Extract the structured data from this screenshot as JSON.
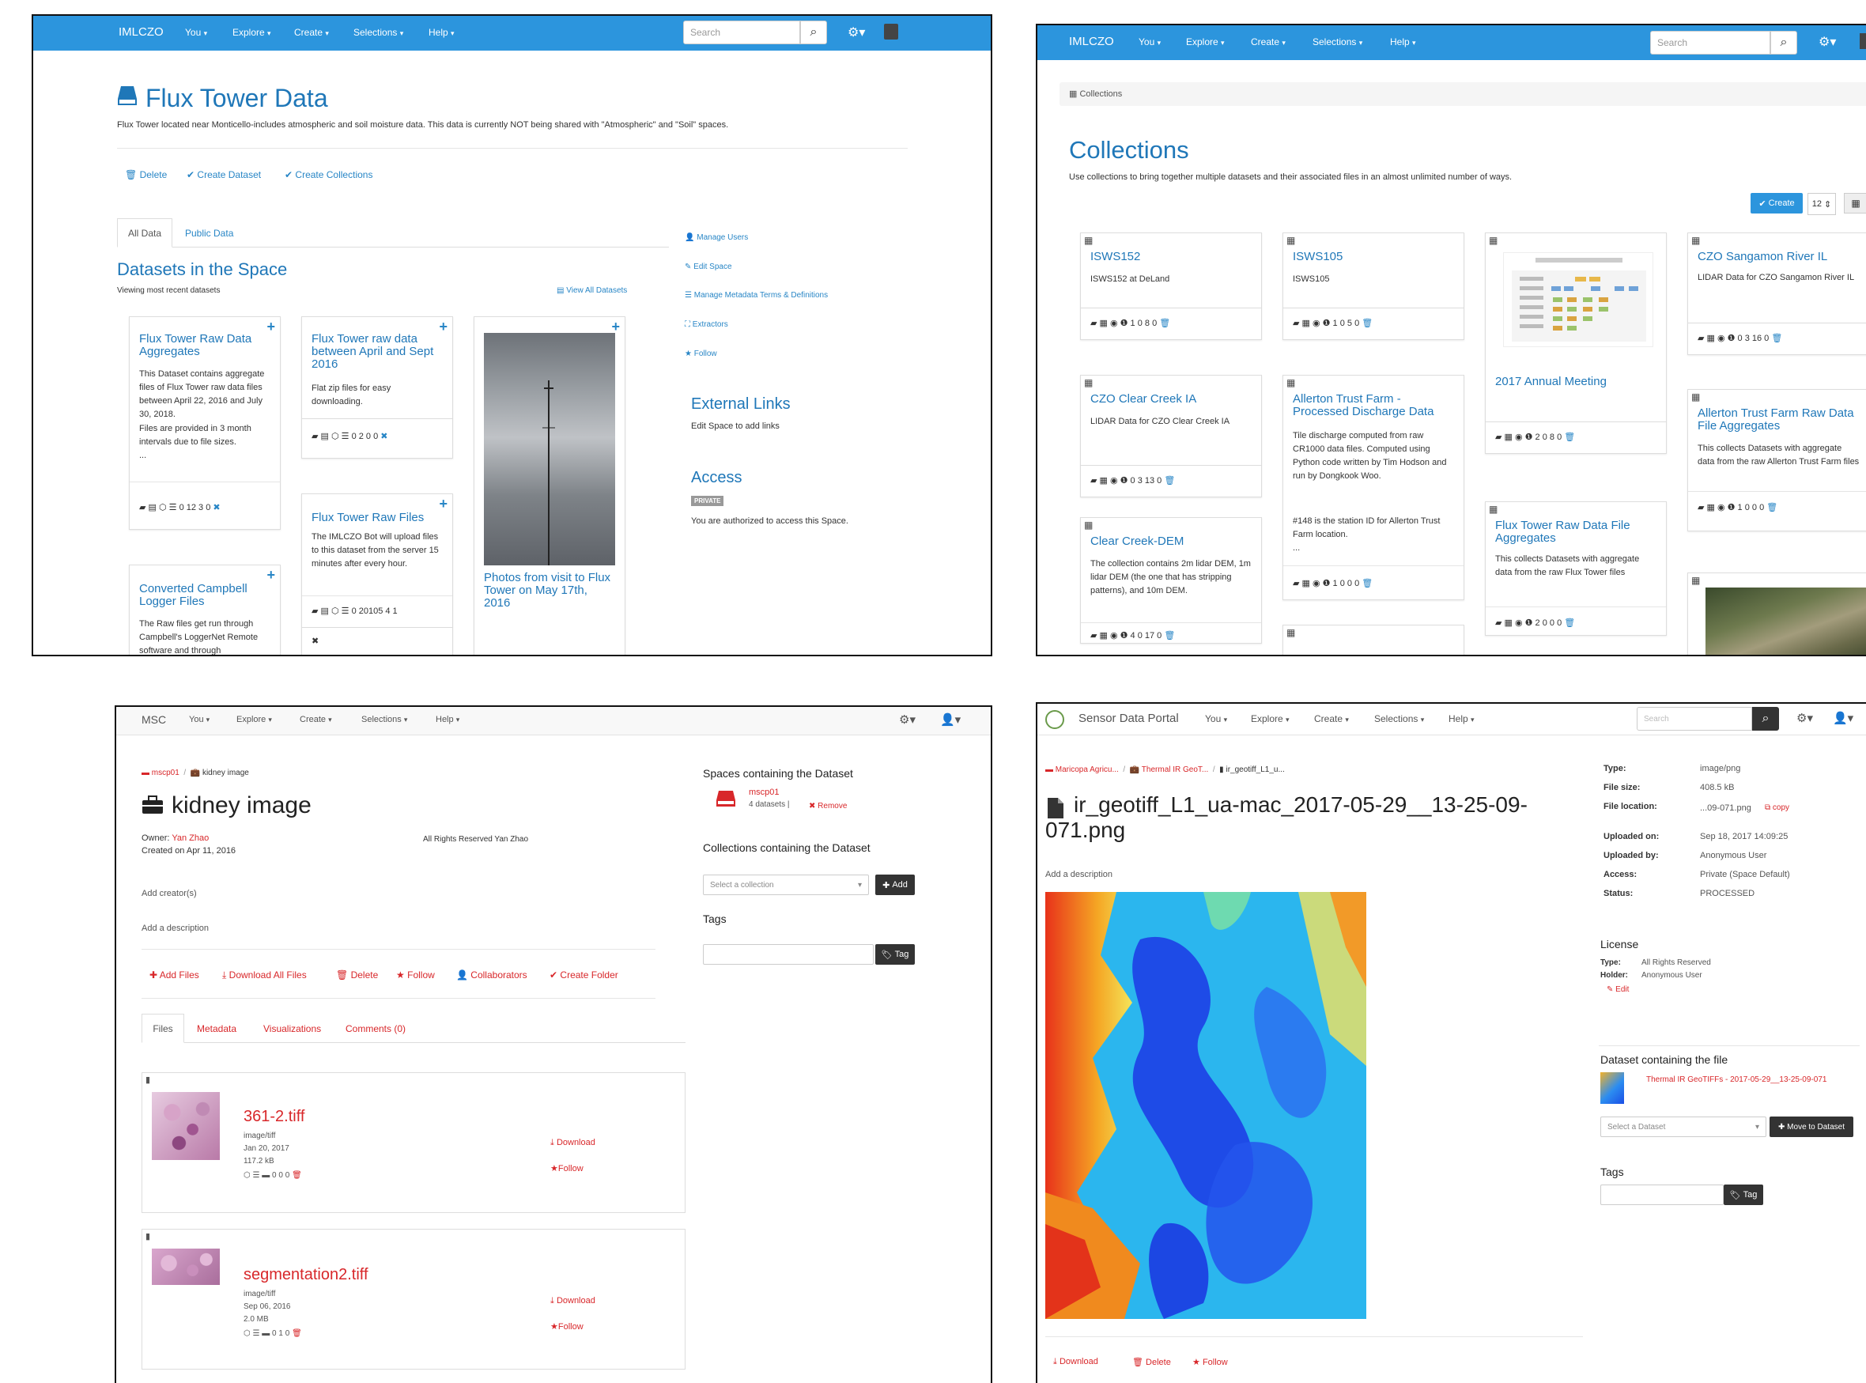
{
  "p1": {
    "nav": {
      "brand": "IMLCZO",
      "items": [
        "You",
        "Explore",
        "Create",
        "Selections",
        "Help"
      ],
      "search_placeholder": "Search"
    },
    "title": "Flux Tower Data",
    "description": "Flux Tower located near Monticello-includes atmospheric and soil moisture data. This data is currently NOT being shared with \"Atmospheric\" and \"Soil\" spaces.",
    "actions": [
      "Delete",
      "Create Dataset",
      "Create Collections"
    ],
    "tabs": [
      "All Data",
      "Public Data"
    ],
    "section_title": "Datasets in the Space",
    "section_sub": "Viewing most recent datasets",
    "view_all": "View All Datasets",
    "cards": [
      {
        "title": "Flux Tower Raw Data Aggregates",
        "desc": "This Dataset contains aggregate files of Flux Tower raw data files between April 22, 2016 and July 30, 2018.",
        "desc2": "Files are provided in 3 month intervals due to file sizes.",
        "desc3": "...",
        "stats": "0  12  3  0"
      },
      {
        "title": "Flux Tower raw data between April and Sept 2016",
        "desc": "Flat zip files for easy downloading.",
        "stats": "0  2  0  0"
      },
      {
        "title": "Photos from visit to Flux Tower on May 17th, 2016"
      },
      {
        "title": "Flux Tower Raw Files",
        "desc": "The IMLCZO Bot will upload files to this dataset from the server 15 minutes after every hour.",
        "stats": "0  20105  4  1"
      },
      {
        "title": "Converted Campbell Logger Files",
        "desc": "The Raw files get run through Campbell's LoggerNet Remote software and through"
      }
    ],
    "side_links": [
      "Manage Users",
      "Edit Space",
      "Manage Metadata Terms & Definitions",
      "Extractors",
      "Follow"
    ],
    "external_title": "External Links",
    "external_sub": "Edit Space to add links",
    "access_title": "Access",
    "access_badge": "PRIVATE",
    "access_sub": "You are authorized to access this Space."
  },
  "p2": {
    "nav": {
      "brand": "IMLCZO",
      "items": [
        "You",
        "Explore",
        "Create",
        "Selections",
        "Help"
      ],
      "search_placeholder": "Search"
    },
    "breadcrumb": "Collections",
    "title": "Collections",
    "description": "Use collections to bring together multiple datasets and their associated files in an almost unlimited number of ways.",
    "create_label": "Create",
    "page_size": "12",
    "cards": [
      {
        "title": "ISWS152",
        "desc": "ISWS152 at DeLand",
        "stats": "1  0  8  0"
      },
      {
        "title": "ISWS105",
        "desc": "ISWS105",
        "stats": "1  0  5  0"
      },
      {
        "title": "2017 Annual Meeting",
        "stats": "2  0  8  0"
      },
      {
        "title": "CZO Sangamon River IL",
        "desc": "LIDAR Data for CZO Sangamon River IL",
        "stats": "0  3  16  0"
      },
      {
        "title": "CZO Clear Creek IA",
        "desc": "LIDAR Data for CZO Clear Creek IA",
        "stats": "0  3  13  0"
      },
      {
        "title": "Allerton Trust Farm - Processed Discharge Data",
        "desc": "Tile discharge computed from raw CR1000 data files. Computed using Python code written by Tim Hodson and run by Dongkook Woo.",
        "desc2": "#148 is the station ID for Allerton Trust Farm location.",
        "desc3": "...",
        "stats": "1  0  0  0"
      },
      {
        "title": "Allerton Trust Farm Raw Data File Aggregates",
        "desc": "This collects Datasets with aggregate data from the raw Allerton Trust Farm files",
        "stats": "1  0  0  0"
      },
      {
        "title": "Clear Creek-DEM",
        "desc": "The collection contains 2m lidar DEM, 1m lidar DEM (the one that has stripping patterns), and 10m DEM.",
        "stats": "4  0  17  0"
      },
      {
        "title": "Flux Tower Raw Data File Aggregates",
        "desc": "This collects Datasets with aggregate data from the raw Flux Tower files",
        "stats": "2  0  0  0"
      }
    ]
  },
  "p3": {
    "nav": {
      "brand": "MSC",
      "items": [
        "You",
        "Explore",
        "Create",
        "Selections",
        "Help"
      ]
    },
    "breadcrumb": [
      "mscp01",
      "kidney image"
    ],
    "title": "kidney image",
    "owner_label": "Owner:",
    "owner": "Yan Zhao",
    "created": "Created on Apr 11, 2016",
    "rights": "All Rights Reserved Yan Zhao",
    "add_creators": "Add creator(s)",
    "add_description": "Add a description",
    "actions": [
      "Add Files",
      "Download All Files",
      "Delete",
      "Follow",
      "Collaborators",
      "Create Folder"
    ],
    "tabs": [
      "Files",
      "Metadata",
      "Visualizations",
      "Comments (0)"
    ],
    "files": [
      {
        "name": "361-2.tiff",
        "type": "image/tiff",
        "date": "Jan 20, 2017",
        "size": "117.2 kB",
        "stats": "0  0  0"
      },
      {
        "name": "segmentation2.tiff",
        "type": "image/tiff",
        "date": "Sep 06, 2016",
        "size": "2.0 MB",
        "stats": "0  1  0"
      }
    ],
    "file_actions": [
      "Download",
      "Follow"
    ],
    "spaces_title": "Spaces containing the Dataset",
    "space_name": "mscp01",
    "space_count": "4 datasets",
    "remove_label": "Remove",
    "collections_title": "Collections containing the Dataset",
    "select_collection": "Select a collection",
    "add_label": "Add",
    "tags_title": "Tags",
    "tag_label": "Tag"
  },
  "p4": {
    "nav": {
      "brand": "Sensor Data Portal",
      "items": [
        "You",
        "Explore",
        "Create",
        "Selections",
        "Help"
      ],
      "search_placeholder": "Search"
    },
    "breadcrumb": [
      "Maricopa Agricu...",
      "Thermal IR GeoT...",
      "ir_geotiff_L1_u..."
    ],
    "title_line1": "ir_geotiff_L1_ua-mac_2017-05-29__13-25-09-",
    "title_line2": "071.png",
    "add_description": "Add a description",
    "actions": [
      "Download",
      "Delete",
      "Follow"
    ],
    "info": [
      {
        "k": "Type:",
        "v": "image/png"
      },
      {
        "k": "File size:",
        "v": "408.5 kB"
      },
      {
        "k": "File location:",
        "v": "...09-071.png"
      },
      {
        "k": "Uploaded on:",
        "v": "Sep 18, 2017 14:09:25"
      },
      {
        "k": "Uploaded by:",
        "v": "Anonymous User"
      },
      {
        "k": "Access:",
        "v": "Private (Space Default)"
      },
      {
        "k": "Status:",
        "v": "PROCESSED"
      }
    ],
    "copy_label": "copy",
    "license_title": "License",
    "license_type_k": "Type:",
    "license_type_v": "All Rights Reserved",
    "license_holder_k": "Holder:",
    "license_holder_v": "Anonymous User",
    "edit_label": "Edit",
    "dataset_title": "Dataset containing the file",
    "dataset_link": "Thermal IR GeoTIFFs - 2017-05-29__13-25-09-071",
    "select_dataset": "Select a Dataset",
    "move_label": "Move to Dataset",
    "tags_title": "Tags",
    "tag_label": "Tag"
  }
}
